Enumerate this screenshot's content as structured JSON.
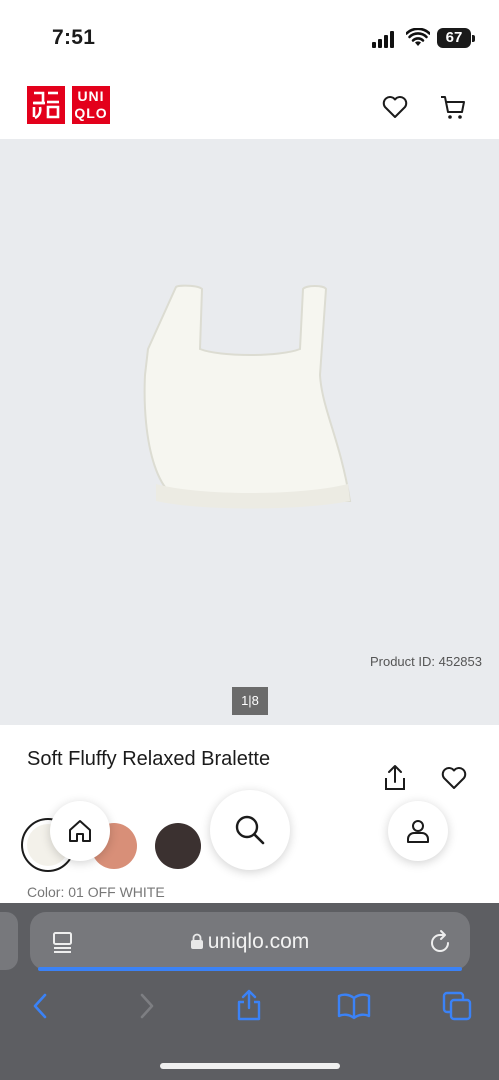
{
  "status": {
    "time": "7:51",
    "battery": "67"
  },
  "header": {
    "logo_top": "ユニ\nクロ",
    "logo_text": "UNI\nQLO"
  },
  "product": {
    "id_text": "Product ID: 452853",
    "pager": "1|8",
    "title": "Soft Fluffy Relaxed Bralette",
    "color_label": "Color: 01 OFF WHITE",
    "swatches": [
      "#f3f1ea",
      "#d88f78",
      "#3b3130"
    ]
  },
  "browser": {
    "url": "uniqlo.com"
  },
  "colors": {
    "brand": "#e3001b",
    "accent": "#3b82f6"
  }
}
